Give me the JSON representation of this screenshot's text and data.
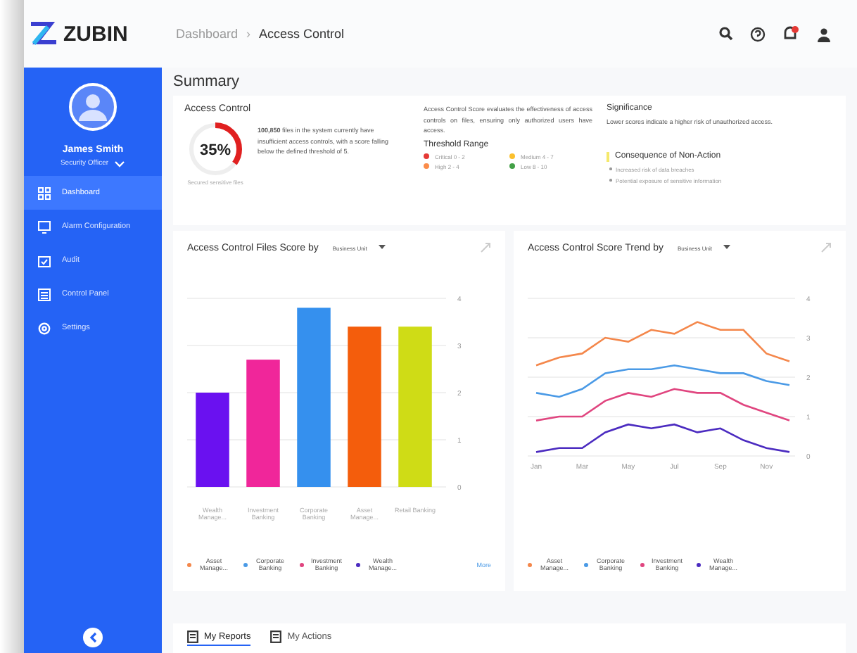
{
  "logo": {
    "text": "ZUBIN"
  },
  "breadcrumb_separator": "›",
  "breadcrumb": [
    {
      "label": "Dashboard",
      "current": false
    },
    {
      "label": "Access Control",
      "current": true
    }
  ],
  "user": {
    "name": "James Smith",
    "role": "Security Officer"
  },
  "sidebar": {
    "items": [
      {
        "label": "Dashboard",
        "selected": true
      },
      {
        "label": "Alarm Configuration",
        "selected": false
      },
      {
        "label": "Audit",
        "selected": false
      },
      {
        "label": "Control Panel",
        "selected": false
      },
      {
        "label": "Settings",
        "selected": false
      }
    ]
  },
  "summary": {
    "title": "Summary",
    "card_title": "Access Control",
    "gauge": {
      "value": "35%",
      "level": 0.35,
      "caption": "Secured sensitive files"
    },
    "finding": "**100,850** files in the system currently have insufficient access controls, with a score falling below the defined threshold of 5.",
    "description": "Access Control Score evaluates the effectiveness of access controls on files, ensuring only authorized users have access.",
    "threshold_title": "Threshold Range",
    "thresholds": [
      {
        "label": "Critical 0 - 2",
        "color": "#e53935"
      },
      {
        "label": "Medium 4 - 7",
        "color": "#fbc02d"
      },
      {
        "label": "High 2 - 4",
        "color": "#fb8c4a"
      },
      {
        "label": "Low 8 - 10",
        "color": "#43a047"
      }
    ],
    "significance_title": "Significance",
    "significance": "Lower scores indicate a higher risk of unauthorized access.",
    "consequence_title": "Consequence of Non-Action",
    "consequences": [
      "Increased risk of data breaches",
      "Potential exposure of sensitive information"
    ]
  },
  "bar_card": {
    "title": "Access Control Files Score by",
    "dropdown": "Business Unit",
    "chart_data": {
      "type": "bar",
      "categories": [
        "Wealth Manage...",
        "Investment Banking",
        "Corporate Banking",
        "Asset Manage...",
        "Retail Banking"
      ],
      "values": [
        2.0,
        2.7,
        3.8,
        3.4,
        3.4
      ],
      "ylim": [
        0,
        4
      ],
      "yticks": [
        0,
        1,
        2,
        3,
        4
      ],
      "grid": true
    },
    "legend": [
      {
        "label": "Asset Manage...",
        "color": "#f4874b"
      },
      {
        "label": "Corporate Banking",
        "color": "#4a9ae6"
      },
      {
        "label": "Investment Banking",
        "color": "#e0457f"
      },
      {
        "label": "Wealth Manage...",
        "color": "#4b2bc0"
      }
    ],
    "more": "More"
  },
  "line_card": {
    "title": "Access Control Score Trend by",
    "dropdown": "Business Unit",
    "chart_data": {
      "type": "line",
      "categories": [
        "Jan",
        null,
        "Mar",
        null,
        "May",
        null,
        "Jul",
        null,
        "Sep",
        null,
        "Nov",
        null
      ],
      "ylim": [
        0,
        4
      ],
      "yticks": [
        0,
        1,
        2,
        3,
        4
      ],
      "grid": true,
      "series": [
        {
          "name": "Asset Manage...",
          "color": "#f4874b",
          "values": [
            2.3,
            2.5,
            2.6,
            3.0,
            2.9,
            3.2,
            3.1,
            3.4,
            3.2,
            3.2,
            2.6,
            2.4
          ]
        },
        {
          "name": "Corporate Banking",
          "color": "#4a9ae6",
          "values": [
            1.6,
            1.5,
            1.7,
            2.1,
            2.2,
            2.2,
            2.3,
            2.2,
            2.1,
            2.1,
            1.9,
            1.8
          ]
        },
        {
          "name": "Investment Banking",
          "color": "#e0457f",
          "values": [
            0.9,
            1.0,
            1.0,
            1.4,
            1.6,
            1.5,
            1.7,
            1.6,
            1.6,
            1.3,
            1.1,
            0.9
          ]
        },
        {
          "name": "Wealth Manage...",
          "color": "#4b2bc0",
          "values": [
            0.1,
            0.2,
            0.2,
            0.6,
            0.8,
            0.7,
            0.8,
            0.6,
            0.7,
            0.4,
            0.2,
            0.1
          ]
        }
      ]
    }
  },
  "bottom_tabs": [
    {
      "label": "My Reports",
      "selected": true
    },
    {
      "label": "My Actions",
      "selected": false
    }
  ]
}
